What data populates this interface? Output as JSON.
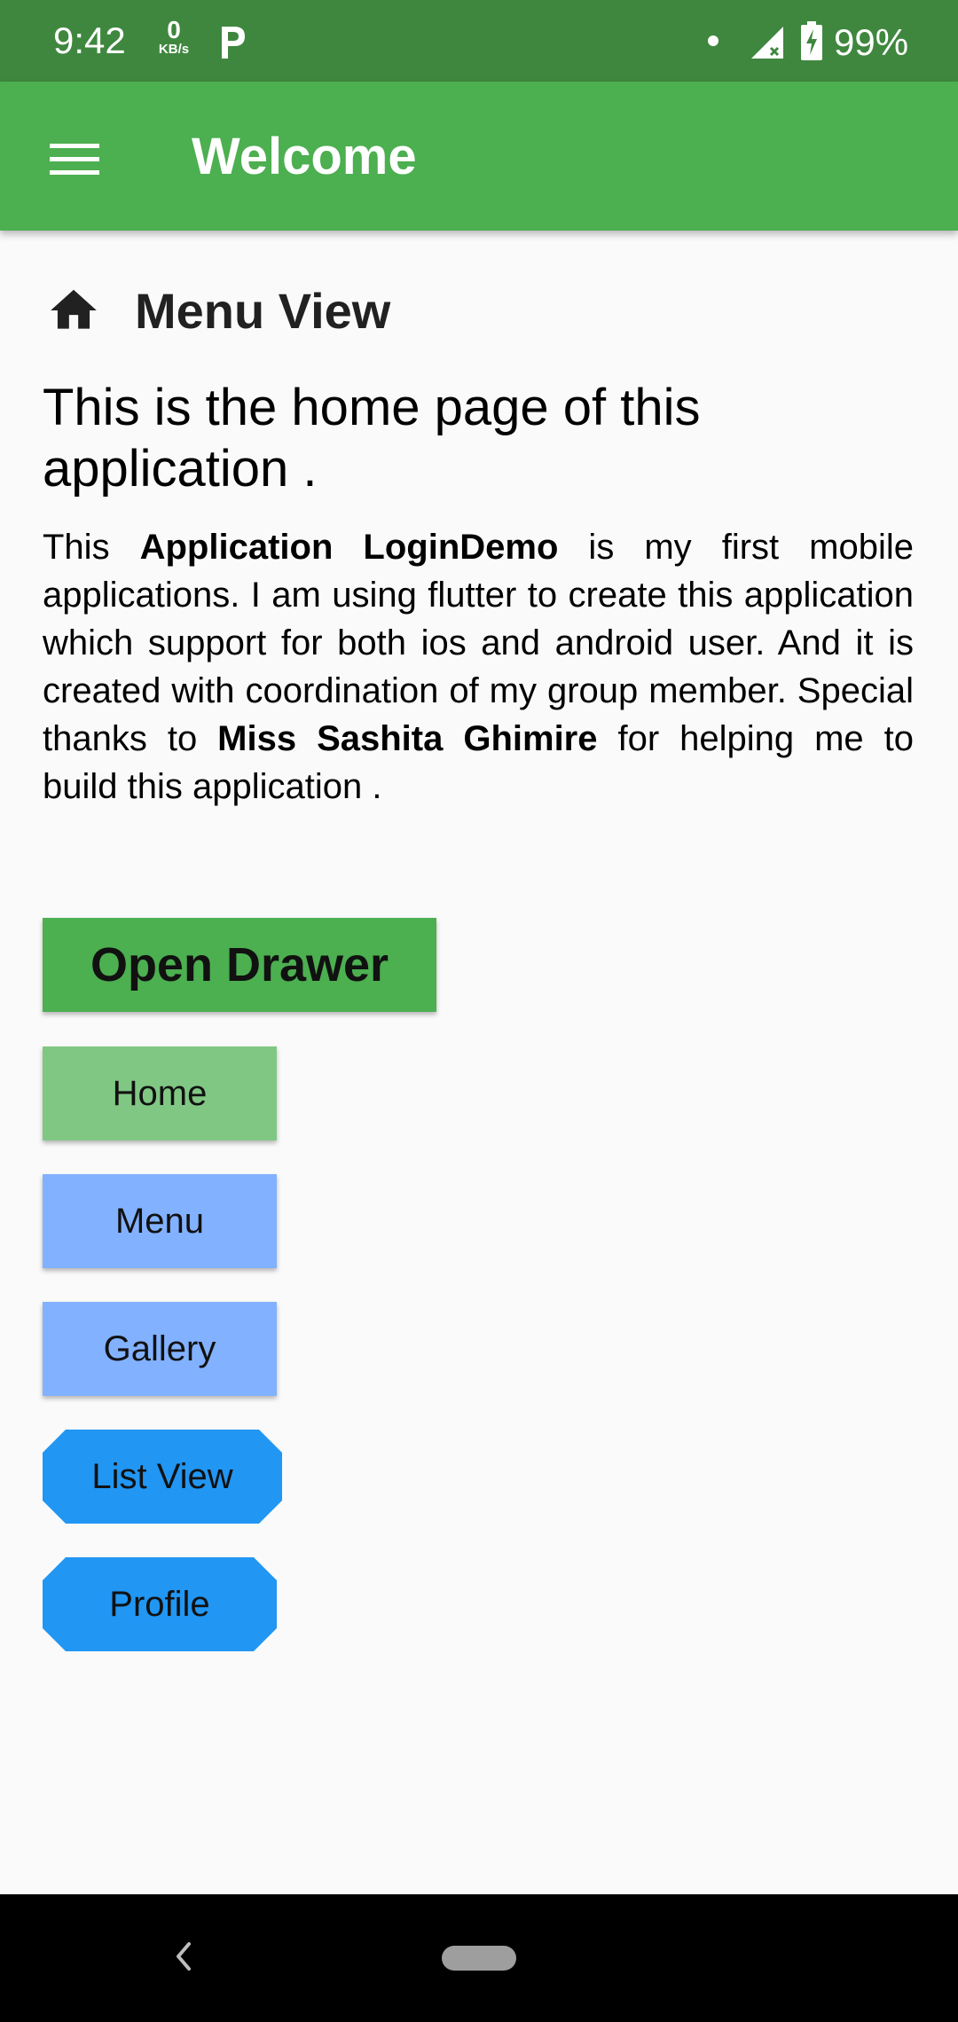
{
  "status_bar": {
    "time": "9:42",
    "kbs_value": "0",
    "kbs_unit": "KB/s",
    "battery_text": "99%",
    "background_color": "#3f873f",
    "icons": [
      "parking-icon",
      "notification-dot-icon",
      "signal-icon",
      "battery-charging-icon"
    ]
  },
  "app_bar": {
    "title": "Welcome",
    "menu_icon": "hamburger-menu-icon",
    "background_color": "#4caf50"
  },
  "section": {
    "icon": "home-icon",
    "title": "Menu View"
  },
  "home_heading": "This is the home page of this application .",
  "description": {
    "part1": "This ",
    "bold1": "Application LoginDemo",
    "part2": " is my first mobile applications. I am using flutter to create this application which support for both ios and android user. And it is created with coordination of my group member. Special thanks to ",
    "bold2": "Miss Sashita Ghimire",
    "part3": " for helping me to build this application ."
  },
  "buttons": {
    "open_drawer": "Open Drawer",
    "home": "Home",
    "menu": "Menu",
    "gallery": "Gallery",
    "list_view": "List View",
    "profile": "Profile"
  },
  "colors": {
    "open_drawer": "#4caf50",
    "home": "#81c784",
    "menu": "#82b1ff",
    "gallery": "#82b1ff",
    "list_view": "#2196f3",
    "profile": "#2196f3"
  },
  "nav_bar": {
    "back_icon": "back-chevron-icon",
    "home_icon": "home-pill-icon"
  }
}
